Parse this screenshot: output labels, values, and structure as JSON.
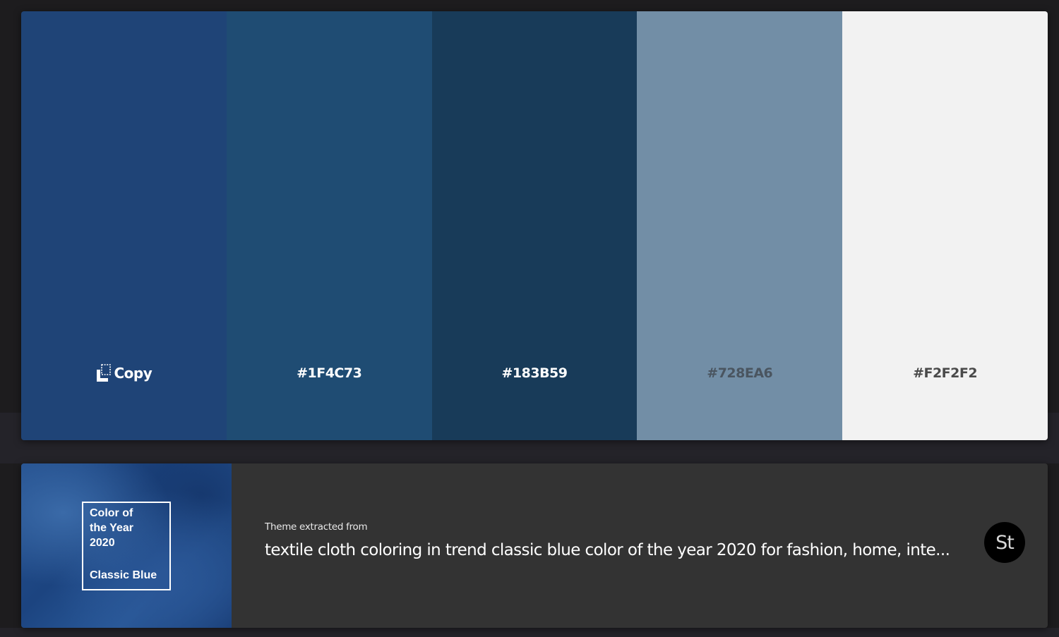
{
  "palette": {
    "swatches": [
      {
        "hex": "#1F4477",
        "label": "",
        "label_color": "#ffffff",
        "hovered": true
      },
      {
        "hex": "#1F4C73",
        "label": "#1F4C73",
        "label_color": "#ffffff",
        "hovered": false
      },
      {
        "hex": "#183B59",
        "label": "#183B59",
        "label_color": "#ffffff",
        "hovered": false
      },
      {
        "hex": "#728EA6",
        "label": "#728EA6",
        "label_color": "#4a5560",
        "hovered": false
      },
      {
        "hex": "#F2F2F2",
        "label": "#F2F2F2",
        "label_color": "#4a4a4a",
        "hovered": false
      }
    ],
    "copy_label": "Copy"
  },
  "source": {
    "caption": "Theme extracted from",
    "title": "textile cloth coloring in trend classic blue color of the year 2020 for fashion, home, inte...",
    "thumbnail": {
      "card_line1": "Color of",
      "card_line2": "the Year",
      "card_line3": "2020",
      "card_name": "Classic Blue"
    },
    "badge": "St"
  }
}
